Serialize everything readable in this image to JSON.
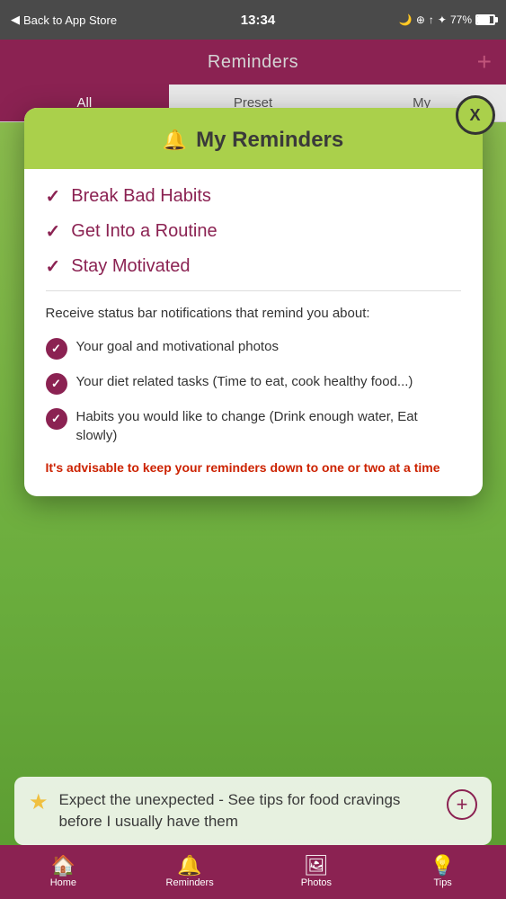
{
  "statusBar": {
    "backText": "Back to App Store",
    "time": "13:34",
    "battery": "77%"
  },
  "header": {
    "title": "Reminders",
    "addLabel": "+"
  },
  "tabs": [
    {
      "label": "All",
      "active": true
    },
    {
      "label": "Preset",
      "active": false
    },
    {
      "label": "My",
      "active": false
    }
  ],
  "modal": {
    "closeLabel": "X",
    "bellIcon": "🔔",
    "title": "My Reminders",
    "reminders": [
      {
        "label": "Break Bad Habits"
      },
      {
        "label": "Get Into a Routine"
      },
      {
        "label": "Stay Motivated"
      }
    ],
    "description": "Receive status bar notifications that remind you about:",
    "bulletItems": [
      {
        "text": "Your goal and motivational photos"
      },
      {
        "text": "Your diet related tasks (Time to eat, cook healthy food...)"
      },
      {
        "text": "Habits you would like to change (Drink enough water, Eat slowly)"
      }
    ],
    "advisory": "It's advisable to keep your reminders down to one or two at a time"
  },
  "backgroundItem": {
    "starIcon": "★",
    "text": "Expect the unexpected - See tips for food cravings before I usually have them",
    "plusLabel": "+"
  },
  "tabBar": [
    {
      "icon": "🏠",
      "label": "Home"
    },
    {
      "icon": "🔔",
      "label": "Reminders"
    },
    {
      "icon": "🖼",
      "label": "Photos"
    },
    {
      "icon": "💡",
      "label": "Tips"
    }
  ]
}
